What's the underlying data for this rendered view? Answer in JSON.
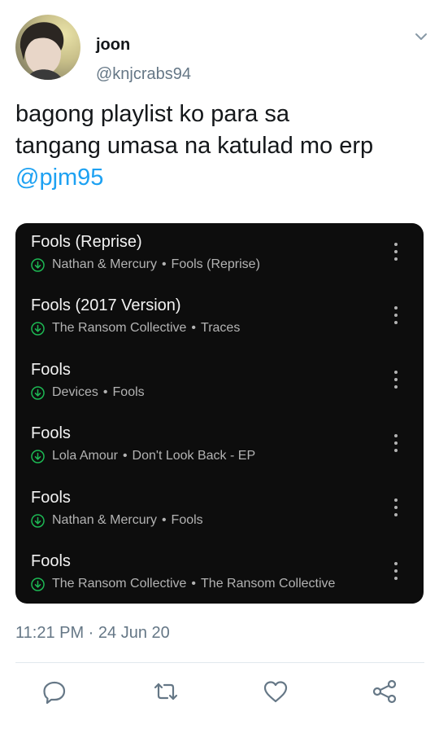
{
  "user": {
    "display_name": "joon",
    "handle": "@knjcrabs94"
  },
  "tweet": {
    "text_line1": "bagong playlist ko para sa",
    "text_line2": "tangang umasa na katulad mo erp",
    "mention": "@pjm95",
    "timestamp": "11:21 PM · 24 Jun 20"
  },
  "playlist": {
    "separator": "•",
    "tracks": [
      {
        "title": "Fools (Reprise)",
        "artist": "Nathan & Mercury",
        "album": "Fools (Reprise)"
      },
      {
        "title": "Fools (2017 Version)",
        "artist": "The Ransom Collective",
        "album": "Traces"
      },
      {
        "title": "Fools",
        "artist": "Devices",
        "album": "Fools"
      },
      {
        "title": "Fools",
        "artist": "Lola Amour",
        "album": "Don't Look Back - EP"
      },
      {
        "title": "Fools",
        "artist": "Nathan & Mercury",
        "album": "Fools"
      },
      {
        "title": "Fools",
        "artist": "The Ransom Collective",
        "album": "The Ransom Collective"
      }
    ]
  },
  "icons": {
    "caret": "chevron-down-icon",
    "download": "download-circle-icon",
    "more": "more-vertical-icon",
    "reply": "reply-icon",
    "retweet": "retweet-icon",
    "like": "heart-icon",
    "share": "share-icon"
  },
  "colors": {
    "accent": "#1da1f2",
    "download_green": "#1db954",
    "card_bg": "#0d0d0d",
    "muted": "#657786"
  }
}
